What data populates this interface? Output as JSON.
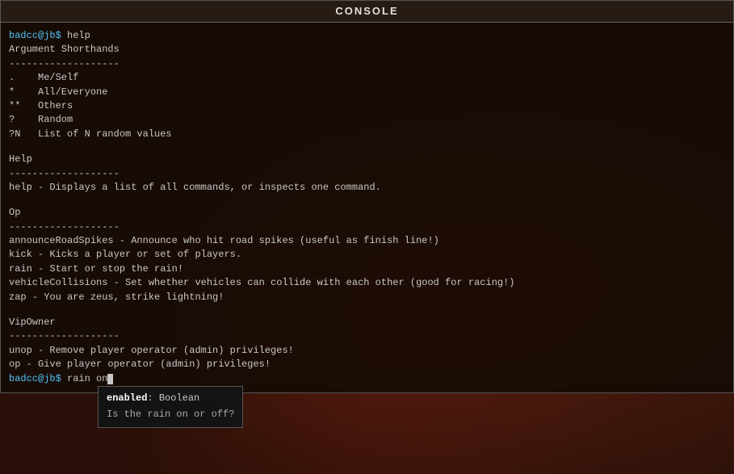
{
  "window": {
    "title": "CONSOLE"
  },
  "console": {
    "lines": [
      {
        "type": "prompt_cmd",
        "prompt": "badcc@jb$ ",
        "text": "help"
      },
      {
        "type": "text",
        "text": "Argument Shorthands"
      },
      {
        "type": "text",
        "text": "-------------------"
      },
      {
        "type": "text",
        "text": ".    Me/Self"
      },
      {
        "type": "text",
        "text": "*    All/Everyone"
      },
      {
        "type": "text",
        "text": "**   Others"
      },
      {
        "type": "text",
        "text": "?    Random"
      },
      {
        "type": "text",
        "text": "?N   List of N random values"
      },
      {
        "type": "empty"
      },
      {
        "type": "text",
        "text": "Help"
      },
      {
        "type": "text",
        "text": "-------------------"
      },
      {
        "type": "text",
        "text": "help - Displays a list of all commands, or inspects one command."
      },
      {
        "type": "empty"
      },
      {
        "type": "text",
        "text": "Op"
      },
      {
        "type": "text",
        "text": "-------------------"
      },
      {
        "type": "text",
        "text": "announceRoadSpikes - Announce who hit road spikes (useful as finish line!)"
      },
      {
        "type": "text",
        "text": "kick - Kicks a player or set of players."
      },
      {
        "type": "text",
        "text": "rain - Start or stop the rain!"
      },
      {
        "type": "text",
        "text": "vehicleCollisions - Set whether vehicles can collide with each other (good for racing!)"
      },
      {
        "type": "text",
        "text": "zap - You are zeus, strike lightning!"
      },
      {
        "type": "empty"
      },
      {
        "type": "text",
        "text": "VipOwner"
      },
      {
        "type": "text",
        "text": "-------------------"
      },
      {
        "type": "text",
        "text": "unop - Remove player operator (admin) privileges!"
      },
      {
        "type": "text",
        "text": "op - Give player operator (admin) privileges!"
      },
      {
        "type": "current_input",
        "prompt": "badcc@jb$ ",
        "text": "rain on"
      }
    ],
    "autocomplete": {
      "param": "enabled",
      "type": "Boolean",
      "description": "Is the rain on or off?"
    }
  }
}
